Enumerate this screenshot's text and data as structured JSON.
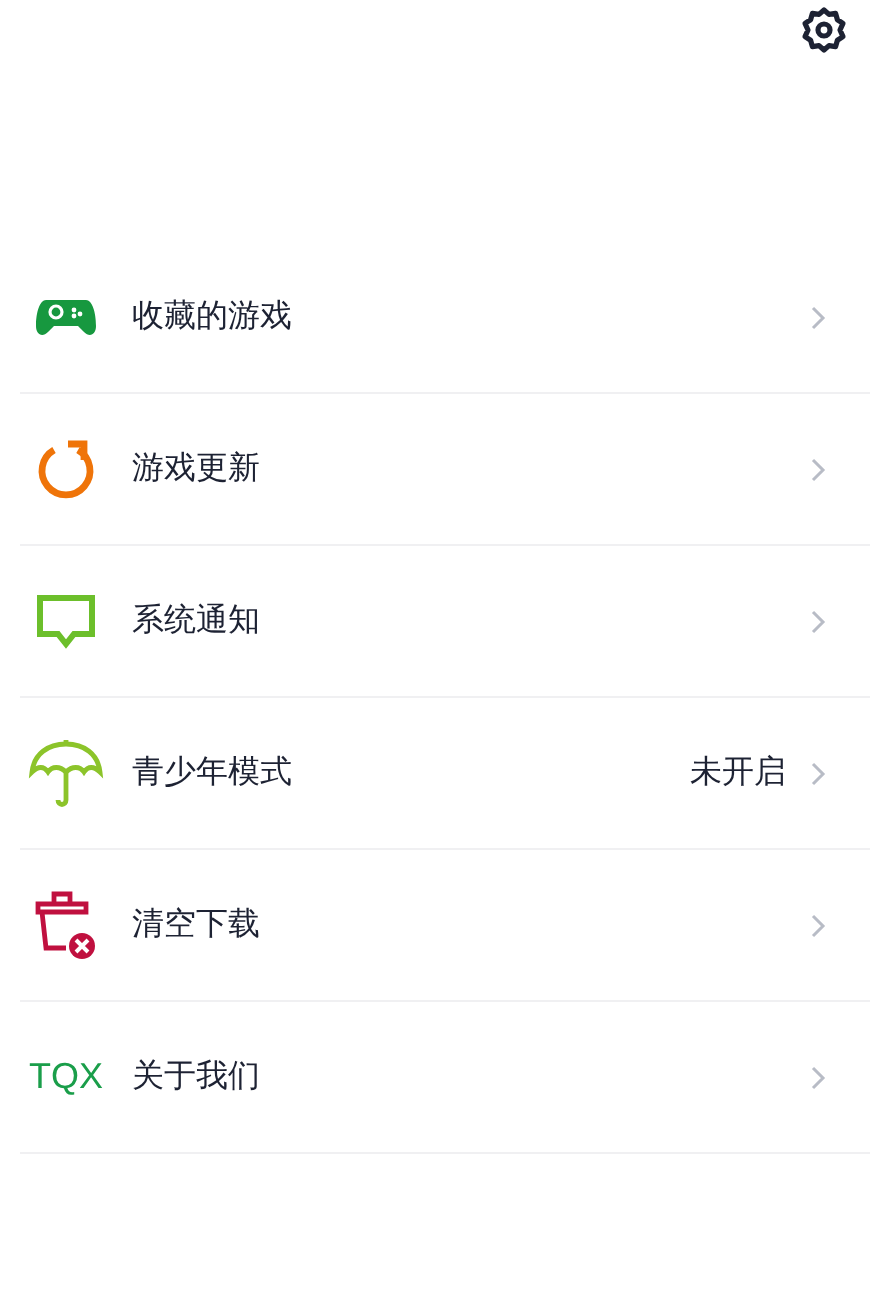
{
  "menu": [
    {
      "kind": "gamepad",
      "label": "收藏的游戏"
    },
    {
      "kind": "refresh",
      "label": "游戏更新"
    },
    {
      "kind": "message",
      "label": "系统通知"
    },
    {
      "kind": "umbrella",
      "label": "青少年模式",
      "value": "未开启"
    },
    {
      "kind": "trash",
      "label": "清空下载"
    },
    {
      "kind": "logo",
      "label": "关于我们",
      "icon_text": "TQX"
    }
  ]
}
